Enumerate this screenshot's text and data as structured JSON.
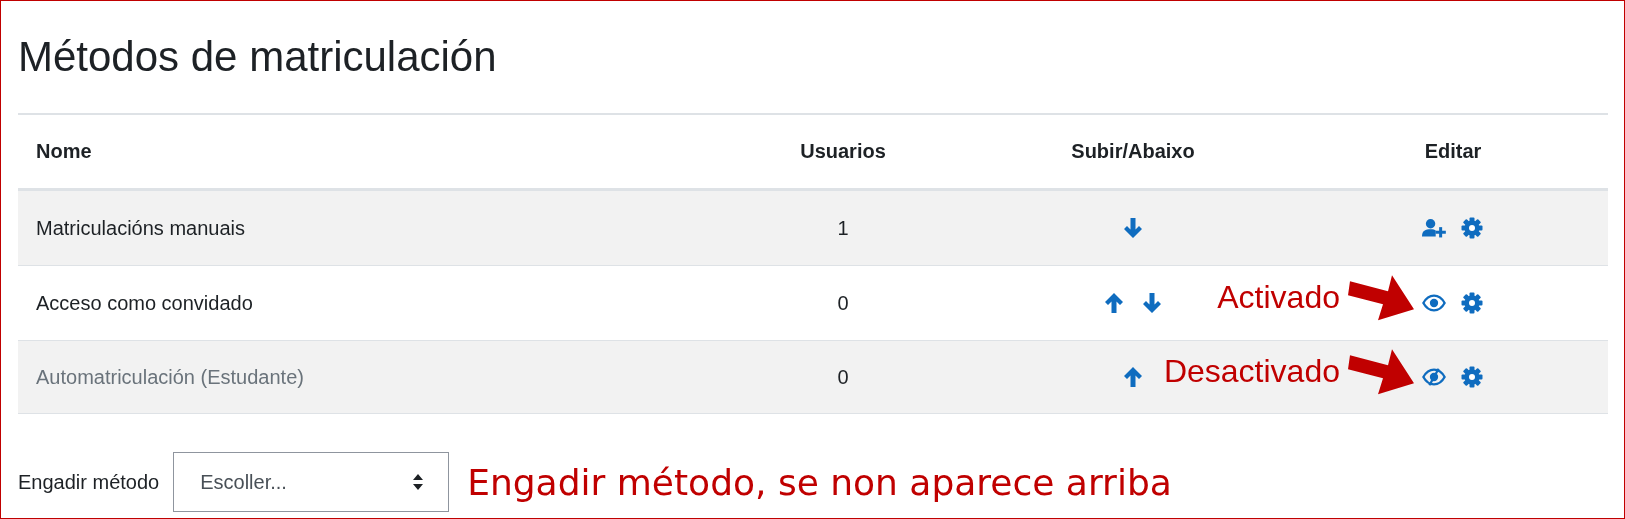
{
  "title": "Métodos de matriculación",
  "table": {
    "columns": [
      "Nome",
      "Usuarios",
      "Subir/Abaixo",
      "Editar"
    ],
    "rows": [
      {
        "name": "Matriculacións manuais",
        "enabled": true,
        "users": "1",
        "moves": [
          {
            "kind": "down"
          }
        ],
        "actions": [
          {
            "kind": "enrol"
          },
          {
            "kind": "settings"
          }
        ]
      },
      {
        "name": "Acceso como convidado",
        "enabled": true,
        "users": "0",
        "moves": [
          {
            "kind": "up"
          },
          {
            "kind": "down"
          }
        ],
        "actions": [
          {
            "kind": "hide"
          },
          {
            "kind": "settings"
          }
        ],
        "annotation": "Activado"
      },
      {
        "name": "Automatriculación (Estudante)",
        "enabled": false,
        "users": "0",
        "moves": [
          {
            "kind": "up"
          }
        ],
        "actions": [
          {
            "kind": "show"
          },
          {
            "kind": "settings"
          }
        ],
        "annotation": "Desactivado"
      }
    ]
  },
  "footer": {
    "label": "Engadir método",
    "select_value": "Escoller...",
    "note": "Engadir método, se non aparece arriba"
  }
}
